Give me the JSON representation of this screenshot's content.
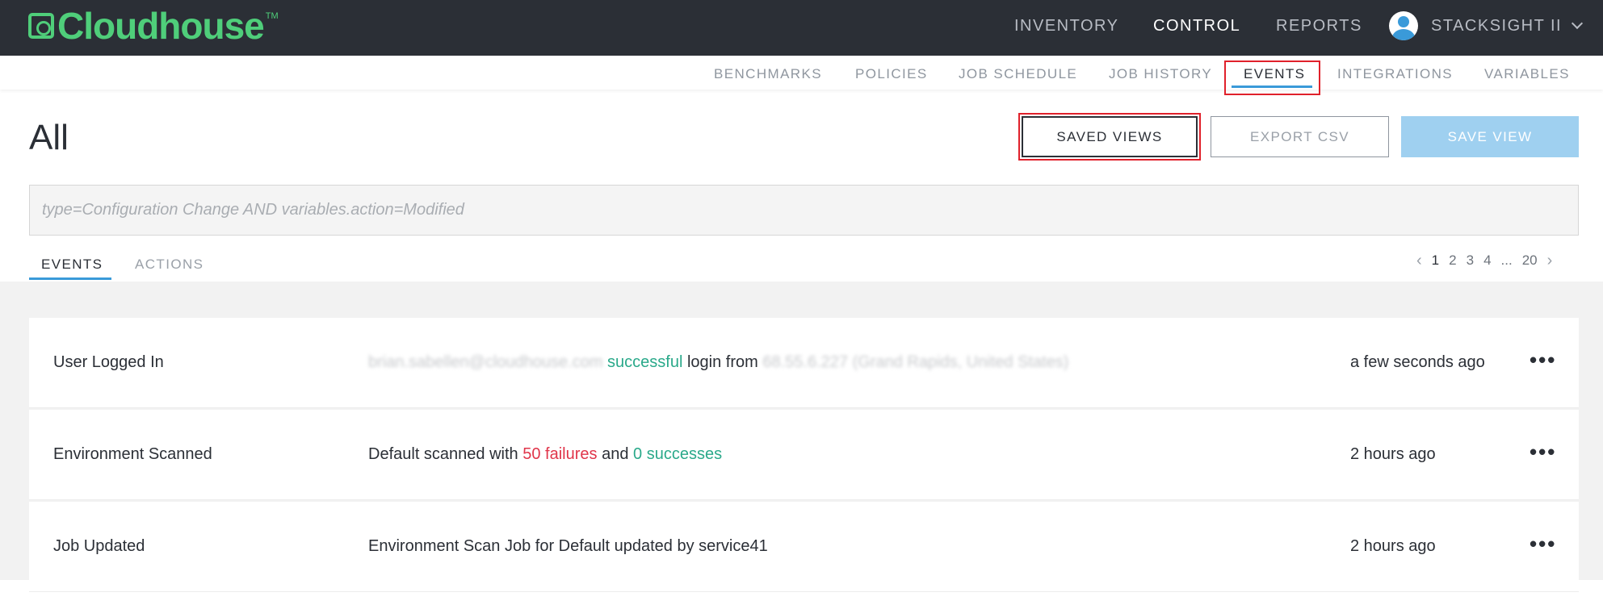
{
  "brand": {
    "name": "Cloudhouse",
    "tm": "TM",
    "color": "#4fce7a"
  },
  "topnav": {
    "items": [
      {
        "label": "INVENTORY",
        "active": false
      },
      {
        "label": "CONTROL",
        "active": true
      },
      {
        "label": "REPORTS",
        "active": false
      }
    ],
    "user": {
      "name": "STACKSIGHT II",
      "icon": "user-avatar-icon"
    }
  },
  "subnav": {
    "items": [
      {
        "label": "BENCHMARKS"
      },
      {
        "label": "POLICIES"
      },
      {
        "label": "JOB SCHEDULE"
      },
      {
        "label": "JOB HISTORY"
      },
      {
        "label": "EVENTS",
        "active": true
      },
      {
        "label": "INTEGRATIONS"
      },
      {
        "label": "VARIABLES"
      }
    ]
  },
  "page": {
    "title": "All",
    "buttons": {
      "saved_views": "SAVED VIEWS",
      "export_csv": "EXPORT CSV",
      "save_view": "SAVE VIEW"
    },
    "query_placeholder": "type=Configuration Change AND variables.action=Modified"
  },
  "tabs": {
    "events": "EVENTS",
    "actions": "ACTIONS"
  },
  "pagination": {
    "prev": "‹",
    "pages": [
      "1",
      "2",
      "3",
      "4",
      "...",
      "20"
    ],
    "current": "1",
    "next": "›"
  },
  "events": [
    {
      "title": "User Logged In",
      "message": {
        "redacted_user": "brian.sabellen@cloudhouse.com",
        "status": "successful",
        "mid": "login from",
        "redacted_ip": "68.55.6.227 (Grand Rapids, United States)"
      },
      "time": "a few seconds ago"
    },
    {
      "title": "Environment Scanned",
      "message": {
        "prefix": "Default scanned with",
        "failures": "50 failures",
        "and": "and",
        "successes": "0 successes"
      },
      "time": "2 hours ago"
    },
    {
      "title": "Job Updated",
      "message": {
        "text": "Environment Scan Job for Default updated by service41"
      },
      "time": "2 hours ago"
    }
  ],
  "more_label": "•••",
  "colors": {
    "topbar": "#2b2f36",
    "accent": "#3a9ad9",
    "success": "#2aa98a",
    "failure": "#e0354a",
    "highlight": "#e0212b"
  }
}
